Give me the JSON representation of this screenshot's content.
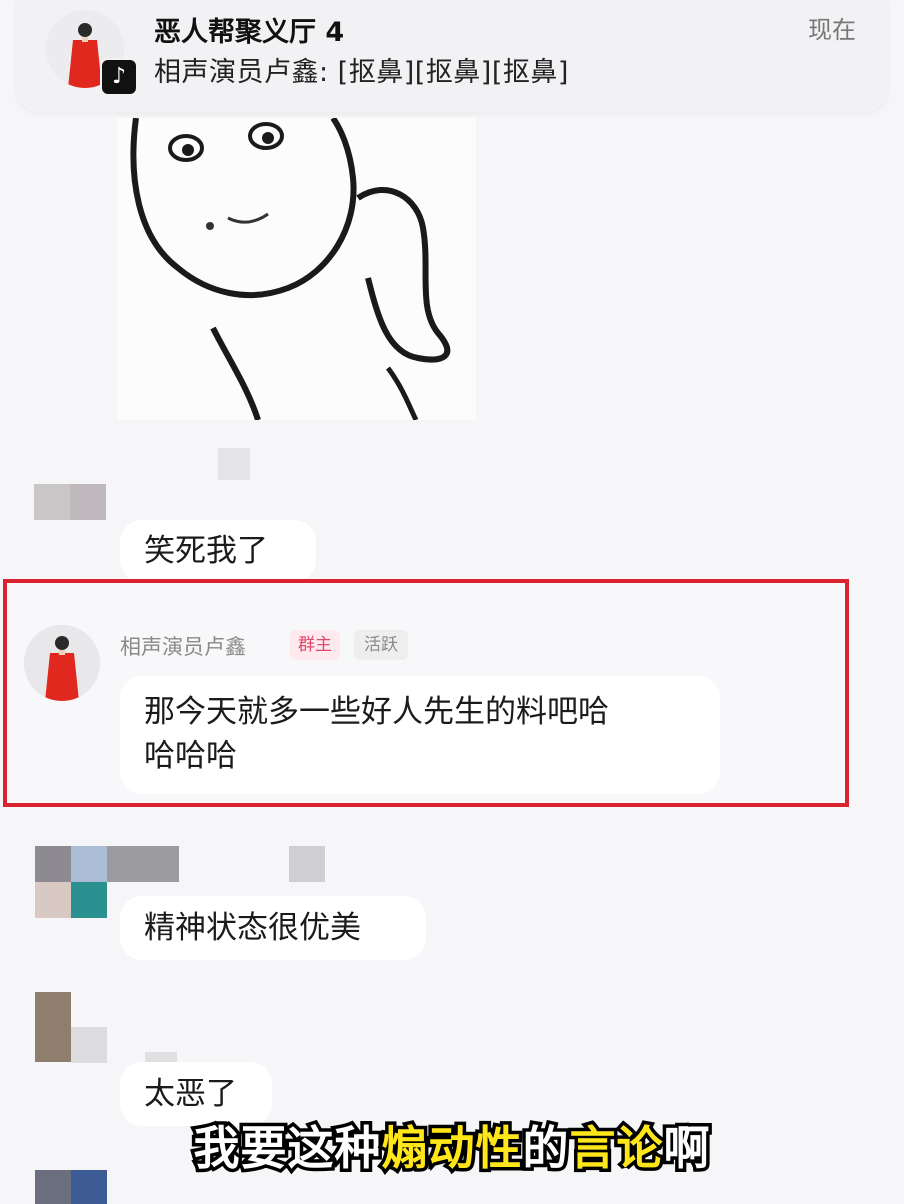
{
  "notification": {
    "title": "恶人帮聚义厅 4",
    "body": "相声演员卢鑫: [抠鼻][抠鼻][抠鼻]",
    "time": "现在",
    "app_icon": "tiktok-icon"
  },
  "messages": [
    {
      "text": "笑死我了"
    },
    {
      "sender": "相声演员卢鑫",
      "tags": [
        "群主",
        "活跃"
      ],
      "text_line1": "那今天就多一些好人先生的料吧哈",
      "text_line2": "哈哈哈"
    },
    {
      "text": "精神状态很优美"
    },
    {
      "text": "太恶了"
    }
  ],
  "caption": {
    "part1": "我要这种",
    "part2": "煽动性",
    "part3": "的",
    "part4": "言论",
    "part5": "啊"
  },
  "colors": {
    "highlight_border": "#d9232f",
    "caption_yellow": "#ffe61a",
    "owner_tag": "#e04a6a"
  }
}
